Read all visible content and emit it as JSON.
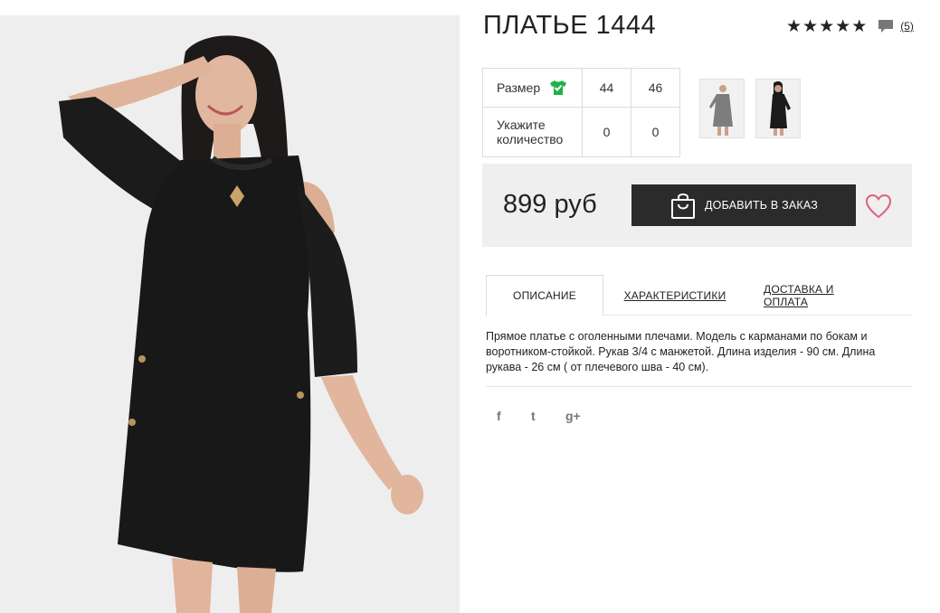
{
  "product": {
    "title": "ПЛАТЬЕ 1444",
    "rating_stars": 5,
    "reviews_link": "(5)"
  },
  "size_table": {
    "size_label": "Размер",
    "qty_label_line1": "Укажите",
    "qty_label_line2": "количество",
    "sizes": [
      "44",
      "46"
    ],
    "quantities": [
      "0",
      "0"
    ]
  },
  "purchase": {
    "price": "899 руб",
    "add_button_label": "ДОБАВИТЬ В ЗАКАЗ"
  },
  "tabs": [
    {
      "label": "ОПИСАНИЕ",
      "active": true
    },
    {
      "label": "ХАРАКТЕРИСТИКИ",
      "active": false
    },
    {
      "label": "ДОСТАВКА И ОПЛАТА",
      "active": false
    }
  ],
  "description": "Прямое платье с оголенными плечами. Модель с карманами по бокам и воротником-стойкой. Рукав 3/4 с манжетой. Длина изделия - 90 см. Длина рукава - 26 см ( от плечевого шва - 40 см).",
  "social": {
    "facebook_glyph": "f",
    "twitter_glyph": "t",
    "googleplus_glyph": "g+"
  },
  "colors": {
    "accent_green": "#1fb14a",
    "heart_pink": "#e0607e",
    "button_dark": "#2b2b2b",
    "panel_gray": "#efefef"
  },
  "icons": [
    "star-icon",
    "comment-icon",
    "tshirt-check-icon",
    "shopping-bag-icon",
    "heart-icon",
    "facebook-icon",
    "twitter-icon",
    "google-plus-icon"
  ]
}
